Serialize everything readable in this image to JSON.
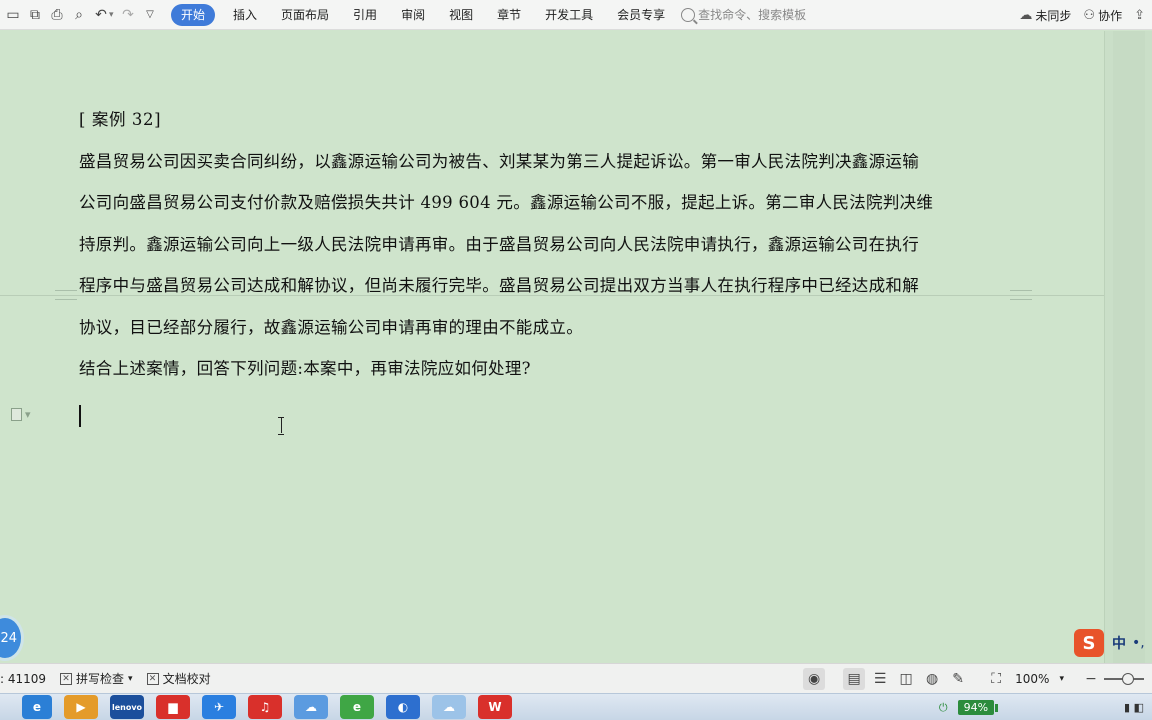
{
  "ribbon": {
    "tabs": [
      "开始",
      "插入",
      "页面布局",
      "引用",
      "审阅",
      "视图",
      "章节",
      "开发工具",
      "会员专享"
    ],
    "active_tab": "开始",
    "search_placeholder": "查找命令、搜索模板",
    "sync_label": "未同步",
    "collab_label": "协作"
  },
  "document": {
    "title_line": "[  案例  32]",
    "lines": [
      "盛昌贸易公司因买卖合同纠纷，以鑫源运输公司为被告、刘某某为第三人提起诉讼。第一审人民法院判决鑫源运输",
      "公司向盛昌贸易公司支付价款及赔偿损失共计 499 604 元。鑫源运输公司不服，提起上诉。第二审人民法院判决维",
      "持原判。鑫源运输公司向上一级人民法院申请再审。由于盛昌贸易公司向人民法院申请执行，鑫源运输公司在执行",
      "程序中与盛昌贸易公司达成和解协议，但尚未履行完毕。盛昌贸易公司提出双方当事人在执行程序中已经达成和解",
      "协议，目已经部分履行，故鑫源运输公司申请再审的理由不能成立。"
    ],
    "question": "结合上述案情，回答下列问题:本案中，再审法院应如何处理?"
  },
  "status": {
    "word_count": ": 41109",
    "spell_check": "拼写检查",
    "doc_proof": "文档校对",
    "zoom": "100%"
  },
  "overlay": {
    "badge": "24",
    "ime_logo": "S",
    "ime_mode": "中",
    "ime_punct": "•,"
  },
  "taskbar": {
    "battery": "94%"
  },
  "colors": {
    "accent": "#3f7bd9",
    "page_background": "#cfe4cc"
  }
}
